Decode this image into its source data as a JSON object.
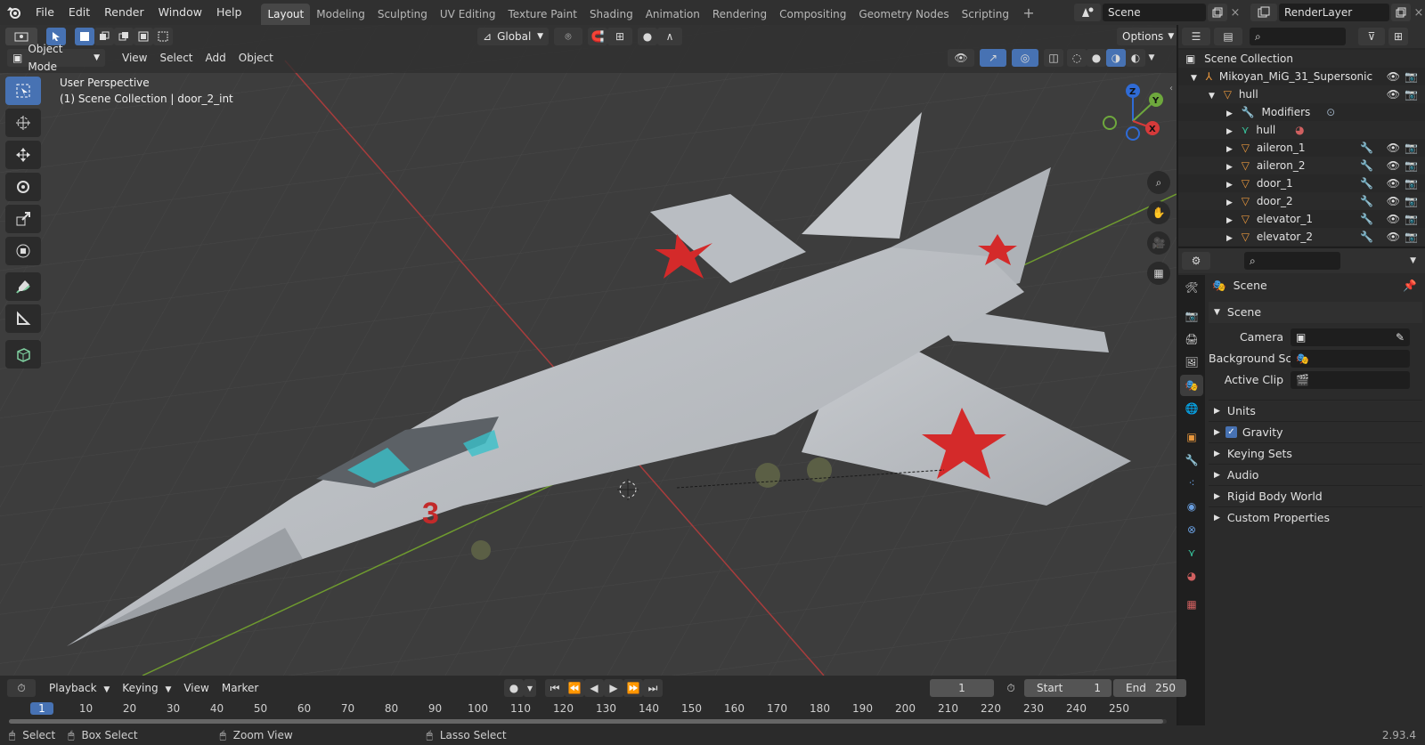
{
  "topbar": {
    "menus": [
      "File",
      "Edit",
      "Render",
      "Window",
      "Help"
    ],
    "workspaces": [
      "Layout",
      "Modeling",
      "Sculpting",
      "UV Editing",
      "Texture Paint",
      "Shading",
      "Animation",
      "Rendering",
      "Compositing",
      "Geometry Nodes",
      "Scripting"
    ],
    "active_workspace": "Layout",
    "scene_name": "Scene",
    "view_layer": "RenderLayer"
  },
  "viewport": {
    "orientation": "Global",
    "options_label": "Options",
    "mode": "Object Mode",
    "menus": [
      "View",
      "Select",
      "Add",
      "Object"
    ],
    "info_line1": "User Perspective",
    "info_line2": "(1) Scene Collection | door_2_int",
    "gizmo_axes": [
      "Z",
      "Y",
      "X"
    ],
    "decal_number": "3"
  },
  "outliner": {
    "root": "Scene Collection",
    "items": [
      {
        "label": "Mikoyan_MiG_31_Supersonic",
        "depth": 1
      },
      {
        "label": "hull",
        "depth": 2
      },
      {
        "label": "Modifiers",
        "depth": 3
      },
      {
        "label": "hull",
        "depth": 3
      },
      {
        "label": "aileron_1",
        "depth": 3
      },
      {
        "label": "aileron_2",
        "depth": 3
      },
      {
        "label": "door_1",
        "depth": 3
      },
      {
        "label": "door_2",
        "depth": 3
      },
      {
        "label": "elevator_1",
        "depth": 3
      },
      {
        "label": "elevator_2",
        "depth": 3
      }
    ]
  },
  "properties": {
    "context": "Scene",
    "section": "Scene",
    "camera_label": "Camera",
    "background_label": "Background Sce...",
    "clip_label": "Active Clip",
    "panels": [
      "Units",
      "Gravity",
      "Keying Sets",
      "Audio",
      "Rigid Body World",
      "Custom Properties"
    ],
    "gravity_checked": true
  },
  "timeline": {
    "menus": [
      "Playback",
      "Keying",
      "View",
      "Marker"
    ],
    "current_frame": "1",
    "start_label": "Start",
    "start_value": "1",
    "end_label": "End",
    "end_value": "250",
    "ticks": [
      "1",
      "10",
      "20",
      "30",
      "40",
      "50",
      "60",
      "70",
      "80",
      "90",
      "100",
      "110",
      "120",
      "130",
      "140",
      "150",
      "160",
      "170",
      "180",
      "190",
      "200",
      "210",
      "220",
      "230",
      "240",
      "250"
    ]
  },
  "statusbar": {
    "select": "Select",
    "box_select": "Box Select",
    "zoom_view": "Zoom View",
    "lasso_select": "Lasso Select",
    "version": "2.93.4"
  }
}
